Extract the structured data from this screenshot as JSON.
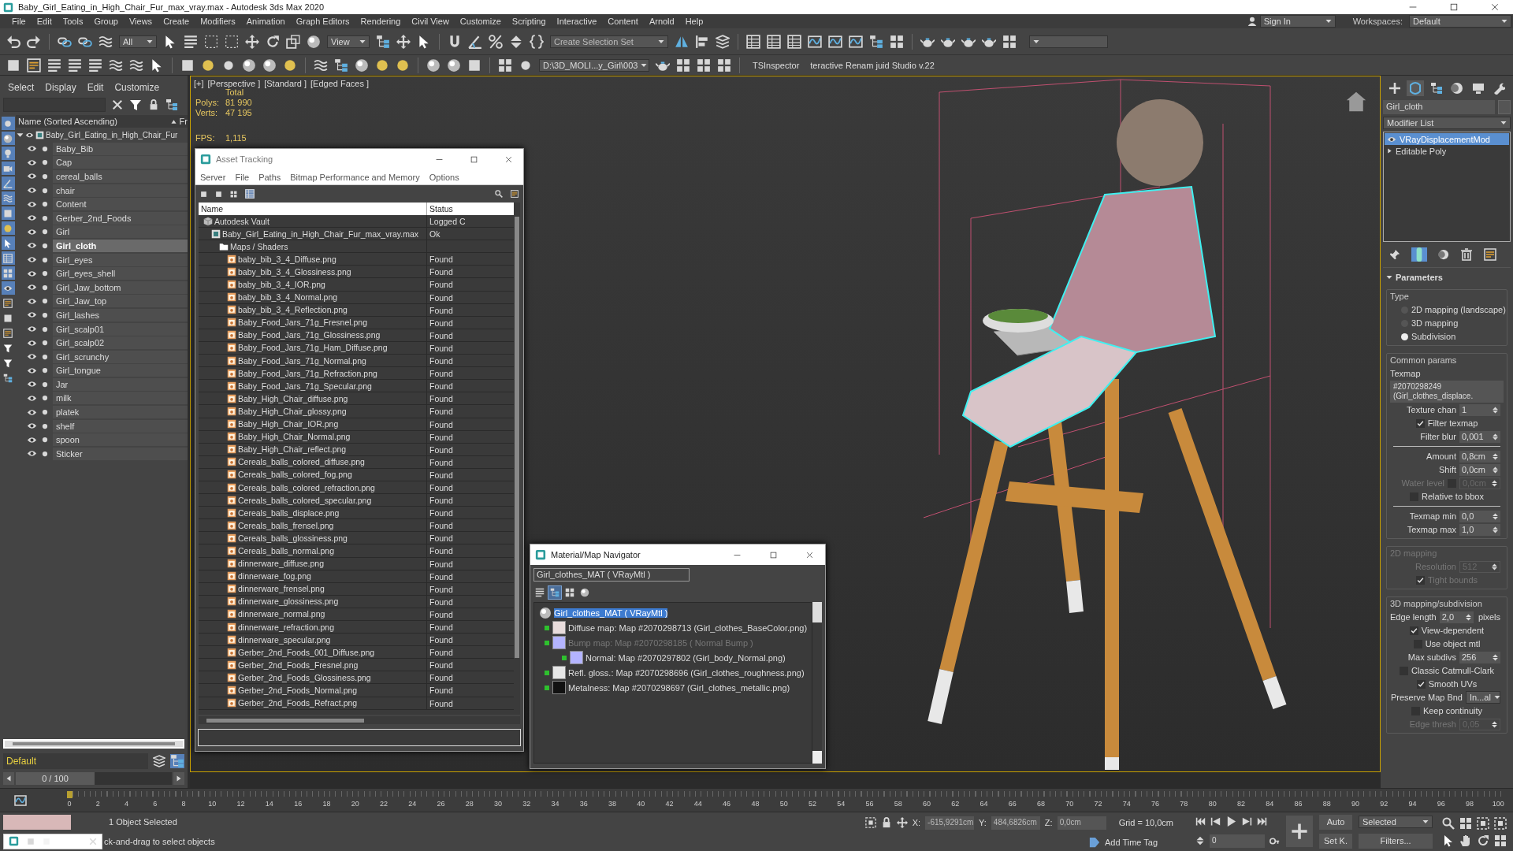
{
  "window": {
    "title": "Baby_Girl_Eating_in_High_Chair_Fur_max_vray.max - Autodesk 3ds Max 2020"
  },
  "menu_bar": {
    "items": [
      "File",
      "Edit",
      "Tools",
      "Group",
      "Views",
      "Create",
      "Modifiers",
      "Animation",
      "Graph Editors",
      "Rendering",
      "Civil View",
      "Customize",
      "Scripting",
      "Interactive",
      "Content",
      "Arnold",
      "Help"
    ],
    "sign_in": "Sign In",
    "workspaces_label": "Workspaces:",
    "workspace": "Default"
  },
  "main_toolbar": {
    "selection_filter": "All",
    "reference_coordinate": "View",
    "selection_set": {
      "placeholder": "Create Selection Set"
    }
  },
  "secondary_toolbar": {
    "path": "D:\\3D_MOLI...y_Girl\\003",
    "scripts": [
      "TSInspector",
      "teractive Renam juid Studio v.22"
    ]
  },
  "scene_explorer": {
    "menus": [
      "Select",
      "Display",
      "Edit",
      "Customize"
    ],
    "filters": [
      {
        "on": true
      },
      {
        "on": true
      },
      {
        "on": true
      },
      {
        "on": true
      },
      {
        "on": true
      },
      {
        "on": true
      },
      {
        "on": true
      },
      {
        "on": true
      },
      {
        "on": true
      },
      {
        "on": true
      },
      {
        "on": true
      },
      {
        "on": true
      },
      {
        "on": false
      },
      {
        "on": false
      },
      {
        "on": false
      },
      {
        "on": false
      },
      {
        "on": false
      },
      {
        "on": false
      }
    ],
    "column": "Name (Sorted Ascending)",
    "column_2": "Fr",
    "root": {
      "name": "Baby_Girl_Eating_in_High_Chair_Fur",
      "expanded": true,
      "children": [
        {
          "name": "Baby_Bib",
          "selected": false
        },
        {
          "name": "Cap",
          "selected": false
        },
        {
          "name": "cereal_balls",
          "selected": false
        },
        {
          "name": "chair",
          "selected": false
        },
        {
          "name": "Content",
          "selected": false
        },
        {
          "name": "Gerber_2nd_Foods",
          "selected": false
        },
        {
          "name": "Girl",
          "selected": false
        },
        {
          "name": "Girl_cloth",
          "selected": true
        },
        {
          "name": "Girl_eyes",
          "selected": false
        },
        {
          "name": "Girl_eyes_shell",
          "selected": false
        },
        {
          "name": "Girl_Jaw_bottom",
          "selected": false
        },
        {
          "name": "Girl_Jaw_top",
          "selected": false
        },
        {
          "name": "Girl_lashes",
          "selected": false
        },
        {
          "name": "Girl_scalp01",
          "selected": false
        },
        {
          "name": "Girl_scalp02",
          "selected": false
        },
        {
          "name": "Girl_scrunchy",
          "selected": false
        },
        {
          "name": "Girl_tongue",
          "selected": false
        },
        {
          "name": "Jar",
          "selected": false
        },
        {
          "name": "milk",
          "selected": false
        },
        {
          "name": "platek",
          "selected": false
        },
        {
          "name": "shelf",
          "selected": false
        },
        {
          "name": "spoon",
          "selected": false
        },
        {
          "name": "Sticker",
          "selected": false
        }
      ]
    },
    "layer": "Default",
    "frame_slider": {
      "label": "0 / 100",
      "level": 0
    }
  },
  "viewport": {
    "labels": [
      "[+]",
      "[Perspective ]",
      "[Standard ]",
      "[Edged Faces ]"
    ],
    "stats_heading": "Total",
    "stats": [
      {
        "label": "Polys:",
        "value": "81 990"
      },
      {
        "label": "Verts:",
        "value": "47 195"
      }
    ],
    "fps": {
      "label": "FPS:",
      "value": "1,115"
    }
  },
  "asset_tracking": {
    "title": "Asset Tracking",
    "menus": [
      "Server",
      "File",
      "Paths",
      "Bitmap Performance and Memory",
      "Options"
    ],
    "columns": [
      "Name",
      "Status"
    ],
    "tree": [
      {
        "kind": "vault",
        "name": "Autodesk Vault",
        "status": "Logged C",
        "children": [
          {
            "kind": "scene",
            "name": "Baby_Girl_Eating_in_High_Chair_Fur_max_vray.max",
            "status": "Ok",
            "children": [
              {
                "kind": "folder",
                "name": "Maps / Shaders",
                "children": [
                  {
                    "kind": "bitmap",
                    "name": "baby_bib_3_4_Diffuse.png",
                    "status": "Found"
                  },
                  {
                    "kind": "bitmap",
                    "name": "baby_bib_3_4_Glossiness.png",
                    "status": "Found"
                  },
                  {
                    "kind": "bitmap",
                    "name": "baby_bib_3_4_IOR.png",
                    "status": "Found"
                  },
                  {
                    "kind": "bitmap",
                    "name": "baby_bib_3_4_Normal.png",
                    "status": "Found"
                  },
                  {
                    "kind": "bitmap",
                    "name": "baby_bib_3_4_Reflection.png",
                    "status": "Found"
                  },
                  {
                    "kind": "bitmap",
                    "name": "Baby_Food_Jars_71g_Fresnel.png",
                    "status": "Found"
                  },
                  {
                    "kind": "bitmap",
                    "name": "Baby_Food_Jars_71g_Glossiness.png",
                    "status": "Found"
                  },
                  {
                    "kind": "bitmap",
                    "name": "Baby_Food_Jars_71g_Ham_Diffuse.png",
                    "status": "Found"
                  },
                  {
                    "kind": "bitmap",
                    "name": "Baby_Food_Jars_71g_Normal.png",
                    "status": "Found"
                  },
                  {
                    "kind": "bitmap",
                    "name": "Baby_Food_Jars_71g_Refraction.png",
                    "status": "Found"
                  },
                  {
                    "kind": "bitmap",
                    "name": "Baby_Food_Jars_71g_Specular.png",
                    "status": "Found"
                  },
                  {
                    "kind": "bitmap",
                    "name": "Baby_High_Chair_diffuse.png",
                    "status": "Found"
                  },
                  {
                    "kind": "bitmap",
                    "name": "Baby_High_Chair_glossy.png",
                    "status": "Found"
                  },
                  {
                    "kind": "bitmap",
                    "name": "Baby_High_Chair_IOR.png",
                    "status": "Found"
                  },
                  {
                    "kind": "bitmap",
                    "name": "Baby_High_Chair_Normal.png",
                    "status": "Found"
                  },
                  {
                    "kind": "bitmap",
                    "name": "Baby_High_Chair_reflect.png",
                    "status": "Found"
                  },
                  {
                    "kind": "bitmap",
                    "name": "Cereals_balls_colored_diffuse.png",
                    "status": "Found"
                  },
                  {
                    "kind": "bitmap",
                    "name": "Cereals_balls_colored_fog.png",
                    "status": "Found"
                  },
                  {
                    "kind": "bitmap",
                    "name": "Cereals_balls_colored_refraction.png",
                    "status": "Found"
                  },
                  {
                    "kind": "bitmap",
                    "name": "Cereals_balls_colored_specular.png",
                    "status": "Found"
                  },
                  {
                    "kind": "bitmap",
                    "name": "Cereals_balls_displace.png",
                    "status": "Found"
                  },
                  {
                    "kind": "bitmap",
                    "name": "Cereals_balls_frensel.png",
                    "status": "Found"
                  },
                  {
                    "kind": "bitmap",
                    "name": "Cereals_balls_glossiness.png",
                    "status": "Found"
                  },
                  {
                    "kind": "bitmap",
                    "name": "Cereals_balls_normal.png",
                    "status": "Found"
                  },
                  {
                    "kind": "bitmap",
                    "name": "dinnerware_diffuse.png",
                    "status": "Found"
                  },
                  {
                    "kind": "bitmap",
                    "name": "dinnerware_fog.png",
                    "status": "Found"
                  },
                  {
                    "kind": "bitmap",
                    "name": "dinnerware_frensel.png",
                    "status": "Found"
                  },
                  {
                    "kind": "bitmap",
                    "name": "dinnerware_glossiness.png",
                    "status": "Found"
                  },
                  {
                    "kind": "bitmap",
                    "name": "dinnerware_normal.png",
                    "status": "Found"
                  },
                  {
                    "kind": "bitmap",
                    "name": "dinnerware_refraction.png",
                    "status": "Found"
                  },
                  {
                    "kind": "bitmap",
                    "name": "dinnerware_specular.png",
                    "status": "Found"
                  },
                  {
                    "kind": "bitmap",
                    "name": "Gerber_2nd_Foods_001_Diffuse.png",
                    "status": "Found"
                  },
                  {
                    "kind": "bitmap",
                    "name": "Gerber_2nd_Foods_Fresnel.png",
                    "status": "Found"
                  },
                  {
                    "kind": "bitmap",
                    "name": "Gerber_2nd_Foods_Glossiness.png",
                    "status": "Found"
                  },
                  {
                    "kind": "bitmap",
                    "name": "Gerber_2nd_Foods_Normal.png",
                    "status": "Found"
                  },
                  {
                    "kind": "bitmap",
                    "name": "Gerber_2nd_Foods_Refract.png",
                    "status": "Found"
                  }
                ]
              }
            ]
          }
        ]
      }
    ]
  },
  "material_navigator": {
    "title": "Material/Map Navigator",
    "material_field": "Girl_clothes_MAT  ( VRayMtl )",
    "view_modes": [
      {
        "selected": false
      },
      {
        "selected": true
      },
      {
        "selected": false
      },
      {
        "selected": false
      }
    ],
    "tree": {
      "name": "Girl_clothes_MAT  ( VRayMtl )",
      "selected": true,
      "children": [
        {
          "name": "Diffuse map: Map #2070298713 (Girl_clothes_BaseColor.png)",
          "color": "#e8dcdc",
          "disabled": false
        },
        {
          "name": "Bump map: Map #2070298185  ( Normal Bump )",
          "color": "#b4b4ff",
          "disabled": true,
          "children": [
            {
              "name": "Normal: Map #2070297802 (Girl_body_Normal.png)",
              "color": "#b4b4ff",
              "disabled": false
            }
          ]
        },
        {
          "name": "Refl. gloss.: Map #2070298696 (Girl_clothes_roughness.png)",
          "color": "#e6e6e6",
          "disabled": false
        },
        {
          "name": "Metalness: Map #2070298697 (Girl_clothes_metallic.png)",
          "color": "#111111",
          "disabled": false
        }
      ]
    }
  },
  "command_panel": {
    "tabs": [
      {
        "selected": false
      },
      {
        "selected": true
      },
      {
        "selected": false
      },
      {
        "selected": false
      },
      {
        "selected": false
      },
      {
        "selected": false
      }
    ],
    "object_name": "Girl_cloth",
    "modifier_list": "Modifier List",
    "stack": [
      {
        "name": "VRayDisplacementMod",
        "selected": true
      },
      {
        "name": "Editable Poly",
        "selected": false
      }
    ],
    "rollout": {
      "title": "Parameters",
      "expanded": true,
      "groups": [
        {
          "label": "Type",
          "disabled": false,
          "items": [
            {
              "kind": "radio",
              "label": "2D mapping (landscape)",
              "selected": false
            },
            {
              "kind": "radio",
              "label": "3D mapping",
              "selected": false
            },
            {
              "kind": "radio",
              "label": "Subdivision",
              "selected": true
            }
          ]
        },
        {
          "label": "Common params",
          "disabled": false,
          "items": [
            {
              "kind": "label",
              "label": "Texmap"
            },
            {
              "kind": "button",
              "label": "#2070298249 (Girl_clothes_displace."
            },
            {
              "kind": "spinner",
              "label": "Texture chan",
              "value": "1",
              "disabled": false
            },
            {
              "kind": "check",
              "label": "Filter texmap",
              "checked": true
            },
            {
              "kind": "spinner",
              "label": "Filter blur",
              "value": "0,001",
              "disabled": false
            },
            {
              "kind": "rule"
            },
            {
              "kind": "spinner",
              "label": "Amount",
              "value": "0,8cm",
              "disabled": false
            },
            {
              "kind": "spinner",
              "label": "Shift",
              "value": "0,0cm",
              "disabled": false
            },
            {
              "kind": "spinner",
              "label": "Water level",
              "value": "0,0cm",
              "disabled": true,
              "checked": false
            },
            {
              "kind": "check",
              "label": "Relative to bbox",
              "checked": false
            },
            {
              "kind": "rule"
            },
            {
              "kind": "spinner",
              "label": "Texmap min",
              "value": "0,0",
              "disabled": false
            },
            {
              "kind": "spinner",
              "label": "Texmap max",
              "value": "1,0",
              "disabled": false
            }
          ]
        },
        {
          "label": "2D mapping",
          "disabled": true,
          "items": [
            {
              "kind": "spinner",
              "label": "Resolution",
              "value": "512",
              "disabled": true
            },
            {
              "kind": "check",
              "label": "Tight bounds",
              "checked": true
            }
          ]
        },
        {
          "label": "3D mapping/subdivision",
          "disabled": false,
          "items": [
            {
              "kind": "spinner",
              "label": "Edge length",
              "value": "2,0",
              "unit": "pixels",
              "disabled": false
            },
            {
              "kind": "check",
              "label": "View-dependent",
              "checked": true
            },
            {
              "kind": "check",
              "label": "Use object mtl",
              "checked": false
            },
            {
              "kind": "spinner",
              "label": "Max subdivs",
              "value": "256",
              "disabled": false
            },
            {
              "kind": "check",
              "label": "Classic Catmull-Clark",
              "checked": false
            },
            {
              "kind": "check",
              "label": "Smooth UVs",
              "checked": true
            },
            {
              "kind": "dropdown",
              "label": "Preserve Map Bnd",
              "value": "In...al"
            },
            {
              "kind": "check",
              "label": "Keep continuity",
              "checked": false
            },
            {
              "kind": "spinner",
              "label": "Edge thresh",
              "value": "0,05",
              "disabled": true
            }
          ]
        }
      ]
    }
  },
  "timeline": {
    "ticks": [
      "0",
      "2",
      "4",
      "6",
      "8",
      "10",
      "12",
      "14",
      "16",
      "18",
      "20",
      "22",
      "24",
      "26",
      "28",
      "30",
      "32",
      "34",
      "36",
      "38",
      "40",
      "42",
      "44",
      "46",
      "48",
      "50",
      "52",
      "54",
      "56",
      "58",
      "60",
      "62",
      "64",
      "66",
      "68",
      "70",
      "72",
      "74",
      "76",
      "78",
      "80",
      "82",
      "84",
      "86",
      "88",
      "90",
      "92",
      "94",
      "96",
      "98",
      "100"
    ]
  },
  "status_bar": {
    "selection": "1 Object Selected",
    "prompt": "ck-and-drag to select objects",
    "coords": [
      {
        "label": "X:",
        "value": "-615,9291cm"
      },
      {
        "label": "Y:",
        "value": "484,6826cm"
      },
      {
        "label": "Z:",
        "value": "0,0cm"
      }
    ],
    "grid": "Grid = 10,0cm",
    "time_tag": "Add Time Tag",
    "auto_key": "Auto",
    "key_filter": "Selected",
    "set_key": "Set K.",
    "filters": "Filters...",
    "frame": "0"
  }
}
